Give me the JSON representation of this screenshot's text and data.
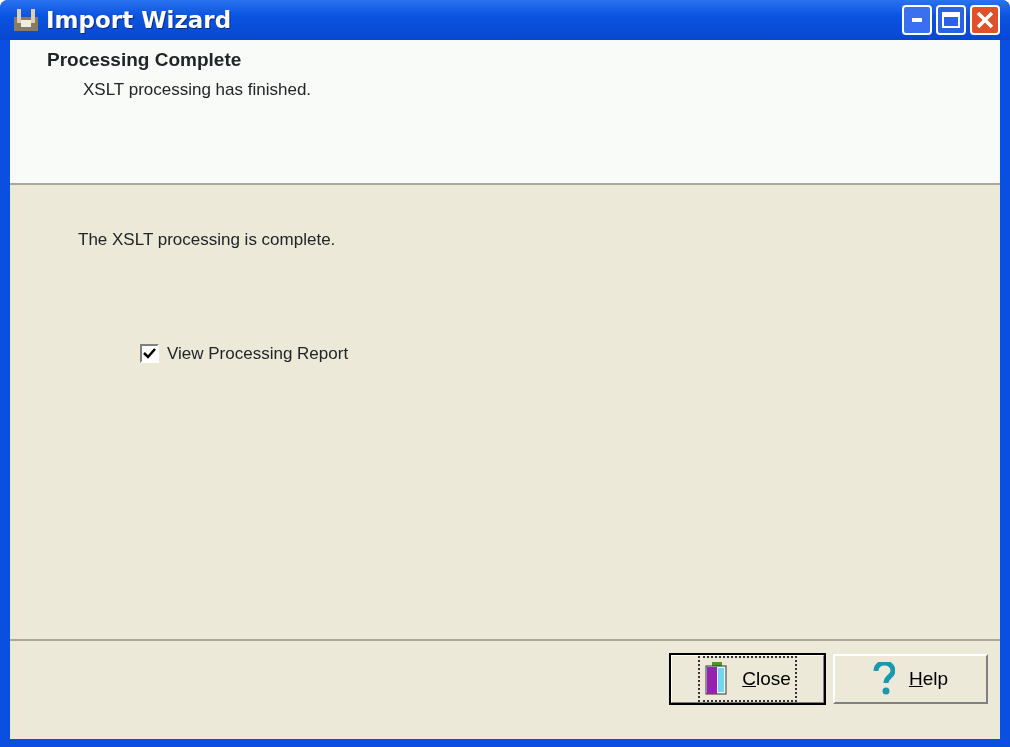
{
  "window": {
    "title": "Import Wizard"
  },
  "header": {
    "title": "Processing Complete",
    "subtitle": "XSLT processing has finished."
  },
  "message": "The XSLT processing is complete.",
  "checkbox": {
    "label": "View Processing Report",
    "checked": true
  },
  "buttons": [
    {
      "label": "Close",
      "kind": "close",
      "default": true
    },
    {
      "label": "Help",
      "kind": "help",
      "default": false
    }
  ]
}
